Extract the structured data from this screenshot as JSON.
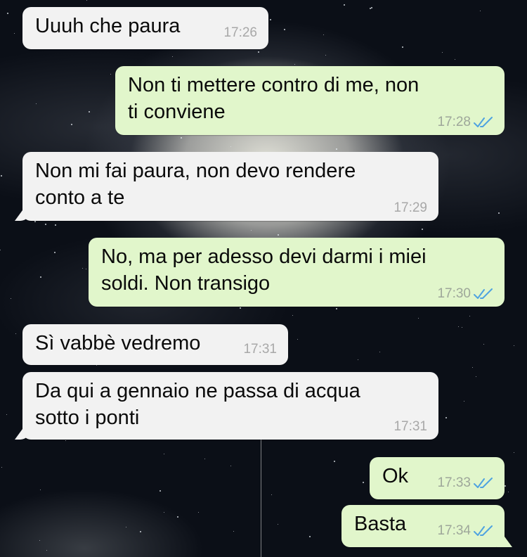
{
  "messages": [
    {
      "text": "Uuuh che paura",
      "time": "17:26",
      "direction": "incoming"
    },
    {
      "text": "Non ti mettere contro di me, non\nti conviene",
      "time": "17:28",
      "direction": "outgoing",
      "status": "read"
    },
    {
      "text": "Non mi fai paura, non devo rendere\nconto a te",
      "time": "17:29",
      "direction": "incoming"
    },
    {
      "text": "No, ma per adesso devi darmi i miei\nsoldi. Non transigo",
      "time": "17:30",
      "direction": "outgoing",
      "status": "read"
    },
    {
      "text": "Sì vabbè vedremo",
      "time": "17:31",
      "direction": "incoming"
    },
    {
      "text": "Da qui a gennaio ne passa di acqua\nsotto i ponti",
      "time": "17:31",
      "direction": "incoming"
    },
    {
      "text": "Ok",
      "time": "17:33",
      "direction": "outgoing",
      "status": "read"
    },
    {
      "text": "Basta",
      "time": "17:34",
      "direction": "outgoing",
      "status": "read"
    }
  ],
  "colors": {
    "incoming_bubble": "#f2f2f2",
    "outgoing_bubble": "#e1f6cb",
    "read_ticks": "#4fa3e0",
    "background": "#0b0f17"
  },
  "icons": {
    "read_receipt": "double-check-icon"
  }
}
